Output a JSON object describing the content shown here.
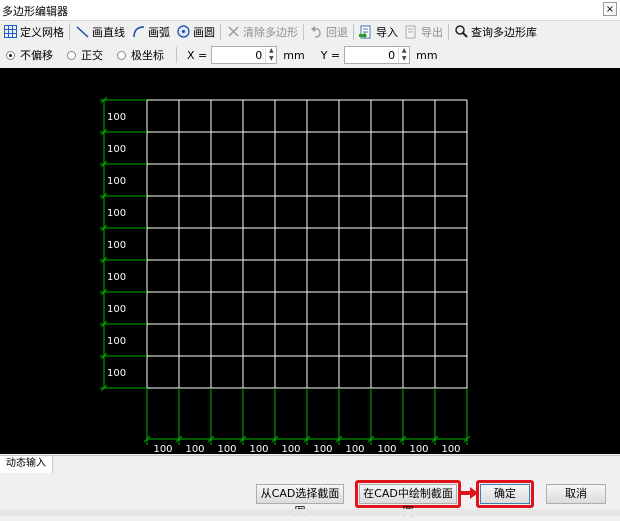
{
  "window": {
    "title": "多边形编辑器",
    "close_label": "×"
  },
  "toolbar": {
    "define_grid": "定义网格",
    "draw_line": "画直线",
    "draw_arc": "画弧",
    "draw_circle": "画圆",
    "clear_polygon": "清除多边形",
    "undo": "回退",
    "import": "导入",
    "export": "导出",
    "query_library": "查询多边形库"
  },
  "options": {
    "no_offset": "不偏移",
    "orthogonal": "正交",
    "polar": "极坐标",
    "selected": "no_offset",
    "x_label": "X =",
    "x_value": "0",
    "y_label": "Y =",
    "y_value": "0",
    "unit": "mm"
  },
  "grid": {
    "rows": 9,
    "cols": 10,
    "row_label": "100",
    "col_label": "100",
    "line_color": "#ffffff",
    "dim_color": "#00b000"
  },
  "tabs": {
    "dynamic_input": "动态输入"
  },
  "buttons": {
    "select_from_cad": "从CAD选择截面图",
    "draw_in_cad": "在CAD中绘制截面图",
    "ok": "确定",
    "cancel": "取消"
  },
  "colors": {
    "highlight": "#e0121b",
    "arrow": "#e0121b"
  }
}
